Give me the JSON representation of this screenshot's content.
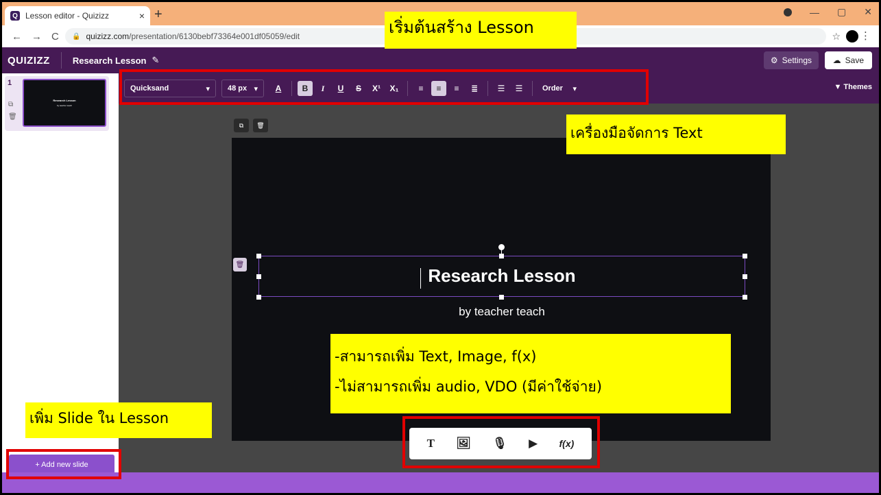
{
  "browser": {
    "tab_title": "Lesson editor - Quizizz",
    "favicon_text": "Q",
    "close_tab": "×",
    "new_tab": "+",
    "url_host": "quizizz.com",
    "url_path": "/presentation/6130bebf73364e001df05059/edit"
  },
  "app": {
    "logo": "QUIZIZZ",
    "lesson_title": "Research Lesson",
    "settings_label": "Settings",
    "save_label": "Save",
    "themes_label": "Themes"
  },
  "toolbar": {
    "font": "Quicksand",
    "size": "48 px",
    "text_color": "A",
    "bold": "B",
    "italic": "I",
    "underline": "U",
    "strike": "S",
    "superscript": "X¹",
    "subscript": "X₁",
    "order": "Order"
  },
  "sidebar": {
    "slide_number": "1",
    "thumb_title": "Research Lesson",
    "thumb_sub": "by teacher teach",
    "add_slide": "+ Add new slide"
  },
  "slide": {
    "title": "Research Lesson",
    "subtitle": "by teacher teach"
  },
  "insert": {
    "text": "T",
    "formula": "f(x)"
  },
  "annotations": {
    "start": "เริ่มต้นสร้าง Lesson",
    "text_tools": "เครื่องมือจัดการ Text",
    "can_add": "-สามารถเพิ่ม Text, Image, f(x)",
    "cannot_add": "-ไม่สามารถเพิ่ม audio, VDO (มีค่าใช้จ่าย)",
    "add_slide": "เพิ่ม Slide ใน Lesson"
  },
  "colors": {
    "header": "#461a55",
    "accent": "#8b50cc",
    "annotation_bg": "#ffff00",
    "annotation_border": "#e10000"
  }
}
